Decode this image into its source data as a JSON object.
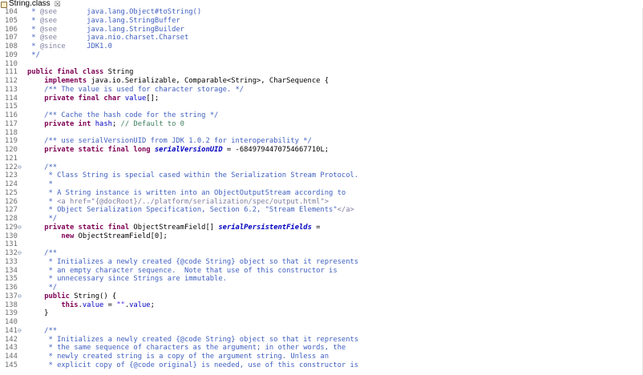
{
  "tab": {
    "title": "String.class",
    "close_symbol": "☒"
  },
  "editor": {
    "lines": [
      {
        "num": "104",
        "fold": "",
        "tokens": [
          {
            "t": " * ",
            "c": "cm"
          },
          {
            "t": "@see",
            "c": "tag"
          },
          {
            "t": "       java.lang.Object#toString()",
            "c": "cm"
          }
        ]
      },
      {
        "num": "105",
        "fold": "",
        "tokens": [
          {
            "t": " * ",
            "c": "cm"
          },
          {
            "t": "@see",
            "c": "tag"
          },
          {
            "t": "       java.lang.StringBuffer",
            "c": "cm"
          }
        ]
      },
      {
        "num": "106",
        "fold": "",
        "tokens": [
          {
            "t": " * ",
            "c": "cm"
          },
          {
            "t": "@see",
            "c": "tag"
          },
          {
            "t": "       java.lang.StringBuilder",
            "c": "cm"
          }
        ]
      },
      {
        "num": "107",
        "fold": "",
        "tokens": [
          {
            "t": " * ",
            "c": "cm"
          },
          {
            "t": "@see",
            "c": "tag"
          },
          {
            "t": "       java.nio.charset.Charset",
            "c": "cm"
          }
        ]
      },
      {
        "num": "108",
        "fold": "",
        "tokens": [
          {
            "t": " * ",
            "c": "cm"
          },
          {
            "t": "@since",
            "c": "tag"
          },
          {
            "t": "     JDK1.0",
            "c": "cm"
          }
        ]
      },
      {
        "num": "109",
        "fold": "",
        "tokens": [
          {
            "t": " */",
            "c": "cm"
          }
        ]
      },
      {
        "num": "110",
        "fold": "",
        "tokens": []
      },
      {
        "num": "111",
        "fold": "",
        "tokens": [
          {
            "t": "public final class",
            "c": "kw"
          },
          {
            "t": " String",
            "c": ""
          }
        ]
      },
      {
        "num": "112",
        "fold": "",
        "tokens": [
          {
            "t": "    ",
            "c": ""
          },
          {
            "t": "implements",
            "c": "kw"
          },
          {
            "t": " java.io.Serializable, Comparable<String>, CharSequence {",
            "c": ""
          }
        ]
      },
      {
        "num": "113",
        "fold": "",
        "tokens": [
          {
            "t": "    /** The value is used for character storage. */",
            "c": "cm"
          }
        ]
      },
      {
        "num": "114",
        "fold": "",
        "tokens": [
          {
            "t": "    ",
            "c": ""
          },
          {
            "t": "private final char",
            "c": "kw"
          },
          {
            "t": " ",
            "c": ""
          },
          {
            "t": "value",
            "c": "fld"
          },
          {
            "t": "[];",
            "c": ""
          }
        ]
      },
      {
        "num": "115",
        "fold": "",
        "tokens": []
      },
      {
        "num": "116",
        "fold": "",
        "tokens": [
          {
            "t": "    /** Cache the hash code for the string */",
            "c": "cm"
          }
        ]
      },
      {
        "num": "117",
        "fold": "",
        "tokens": [
          {
            "t": "    ",
            "c": ""
          },
          {
            "t": "private int",
            "c": "kw"
          },
          {
            "t": " ",
            "c": ""
          },
          {
            "t": "hash",
            "c": "fld"
          },
          {
            "t": "; ",
            "c": ""
          },
          {
            "t": "// Default to 0",
            "c": "lc"
          }
        ]
      },
      {
        "num": "118",
        "fold": "",
        "tokens": []
      },
      {
        "num": "119",
        "fold": "",
        "tokens": [
          {
            "t": "    /** use serialVersionUID from JDK 1.0.2 for interoperability */",
            "c": "cm"
          }
        ]
      },
      {
        "num": "120",
        "fold": "",
        "tokens": [
          {
            "t": "    ",
            "c": ""
          },
          {
            "t": "private static final long",
            "c": "kw"
          },
          {
            "t": " ",
            "c": ""
          },
          {
            "t": "serialVersionUID",
            "c": "sfld"
          },
          {
            "t": " = -6849794470754667710L;",
            "c": ""
          }
        ]
      },
      {
        "num": "121",
        "fold": "",
        "tokens": []
      },
      {
        "num": "122",
        "fold": "⊖",
        "tokens": [
          {
            "t": "    /**",
            "c": "cm"
          }
        ]
      },
      {
        "num": "123",
        "fold": "",
        "tokens": [
          {
            "t": "     * Class String is special cased within the Serialization Stream Protocol.",
            "c": "cm"
          }
        ]
      },
      {
        "num": "124",
        "fold": "",
        "tokens": [
          {
            "t": "     *",
            "c": "cm"
          }
        ]
      },
      {
        "num": "125",
        "fold": "",
        "tokens": [
          {
            "t": "     * A String instance is written into an ObjectOutputStream according to",
            "c": "cm"
          }
        ]
      },
      {
        "num": "126",
        "fold": "",
        "tokens": [
          {
            "t": "     * ",
            "c": "cm"
          },
          {
            "t": "<a href=\"{@docRoot}/../platform/serialization/spec/output.html\">",
            "c": "tag"
          }
        ]
      },
      {
        "num": "127",
        "fold": "",
        "tokens": [
          {
            "t": "     * Object Serialization Specification, Section 6.2, \"Stream Elements\"",
            "c": "cm"
          },
          {
            "t": "</a>",
            "c": "tag"
          }
        ]
      },
      {
        "num": "128",
        "fold": "",
        "tokens": [
          {
            "t": "     */",
            "c": "cm"
          }
        ]
      },
      {
        "num": "129",
        "fold": "⊖",
        "tokens": [
          {
            "t": "    ",
            "c": ""
          },
          {
            "t": "private static final",
            "c": "kw"
          },
          {
            "t": " ObjectStreamField[] ",
            "c": ""
          },
          {
            "t": "serialPersistentFields",
            "c": "sfld"
          },
          {
            "t": " =",
            "c": ""
          }
        ]
      },
      {
        "num": "130",
        "fold": "",
        "tokens": [
          {
            "t": "        ",
            "c": ""
          },
          {
            "t": "new",
            "c": "kw"
          },
          {
            "t": " ObjectStreamField[0];",
            "c": ""
          }
        ]
      },
      {
        "num": "131",
        "fold": "",
        "tokens": []
      },
      {
        "num": "132",
        "fold": "⊖",
        "tokens": [
          {
            "t": "    /**",
            "c": "cm"
          }
        ]
      },
      {
        "num": "133",
        "fold": "",
        "tokens": [
          {
            "t": "     * Initializes a newly created {@code String} object so that it represents",
            "c": "cm"
          }
        ]
      },
      {
        "num": "134",
        "fold": "",
        "tokens": [
          {
            "t": "     * an empty character sequence.  Note that use of this constructor is",
            "c": "cm"
          }
        ]
      },
      {
        "num": "135",
        "fold": "",
        "tokens": [
          {
            "t": "     * unnecessary since Strings are immutable.",
            "c": "cm"
          }
        ]
      },
      {
        "num": "136",
        "fold": "",
        "tokens": [
          {
            "t": "     */",
            "c": "cm"
          }
        ]
      },
      {
        "num": "137",
        "fold": "⊖",
        "tokens": [
          {
            "t": "    ",
            "c": ""
          },
          {
            "t": "public",
            "c": "kw"
          },
          {
            "t": " String() {",
            "c": ""
          }
        ]
      },
      {
        "num": "138",
        "fold": "",
        "tokens": [
          {
            "t": "        ",
            "c": ""
          },
          {
            "t": "this",
            "c": "kw"
          },
          {
            "t": ".",
            "c": ""
          },
          {
            "t": "value",
            "c": "fld"
          },
          {
            "t": " = ",
            "c": ""
          },
          {
            "t": "\"\"",
            "c": "str"
          },
          {
            "t": ".",
            "c": ""
          },
          {
            "t": "value",
            "c": "fld"
          },
          {
            "t": ";",
            "c": ""
          }
        ]
      },
      {
        "num": "139",
        "fold": "",
        "tokens": [
          {
            "t": "    }",
            "c": ""
          }
        ]
      },
      {
        "num": "140",
        "fold": "",
        "tokens": []
      },
      {
        "num": "141",
        "fold": "⊖",
        "tokens": [
          {
            "t": "    /**",
            "c": "cm"
          }
        ]
      },
      {
        "num": "142",
        "fold": "",
        "tokens": [
          {
            "t": "     * Initializes a newly created {@code String} object so that it represents",
            "c": "cm"
          }
        ]
      },
      {
        "num": "143",
        "fold": "",
        "tokens": [
          {
            "t": "     * the same sequence of characters as the argument; in other words, the",
            "c": "cm"
          }
        ]
      },
      {
        "num": "144",
        "fold": "",
        "tokens": [
          {
            "t": "     * newly created string is a copy of the argument string. Unless an",
            "c": "cm"
          }
        ]
      },
      {
        "num": "145",
        "fold": "",
        "tokens": [
          {
            "t": "     * explicit copy of {@code original} is needed, use of this constructor is",
            "c": "cm"
          }
        ]
      }
    ]
  },
  "icons": {
    "file": "java-class-file-icon",
    "close": "close-icon",
    "fold": "collapse-fold-icon"
  },
  "colors": {
    "keyword": "#7f0055",
    "javadoc": "#3f5fbf",
    "javadoc_tag": "#7f7f9f",
    "line_comment": "#3f7f5f",
    "string": "#2a00ff",
    "field": "#0000c0",
    "line_number": "#6e6e6e"
  }
}
